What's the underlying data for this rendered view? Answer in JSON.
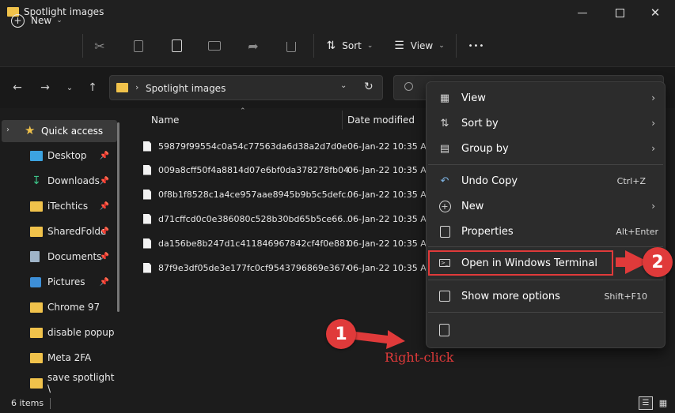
{
  "window": {
    "title": "Spotlight images"
  },
  "toolbar": {
    "new_label": "New",
    "sort_label": "Sort",
    "view_label": "View",
    "more_label": "•••"
  },
  "address": {
    "path": "Spotlight images"
  },
  "sidebar": {
    "quick_access": "Quick access",
    "items": [
      {
        "label": "Desktop",
        "pinned": true
      },
      {
        "label": "Downloads",
        "pinned": true
      },
      {
        "label": "iTechtics",
        "pinned": true
      },
      {
        "label": "SharedFolde",
        "pinned": true
      },
      {
        "label": "Documents",
        "pinned": true
      },
      {
        "label": "Pictures",
        "pinned": true
      },
      {
        "label": "Chrome 97",
        "pinned": false
      },
      {
        "label": "disable popup",
        "pinned": false
      },
      {
        "label": "Meta 2FA",
        "pinned": false
      },
      {
        "label": "save spotlight \\",
        "pinned": false
      }
    ]
  },
  "columns": {
    "name": "Name",
    "date_modified": "Date modified"
  },
  "files": [
    {
      "name": "59879f99554c0a54c77563da6d38a2d7d0e...",
      "date": "06-Jan-22 10:35 AM"
    },
    {
      "name": "009a8cff50f4a8814d07e6bf0da378278fb04...",
      "date": "06-Jan-22 10:35 AM"
    },
    {
      "name": "0f8b1f8528c1a4ce957aae8945b9b5c5defc...",
      "date": "06-Jan-22 10:35 AM"
    },
    {
      "name": "d71cffcd0c0e386080c528b30bd65b5ce66...",
      "date": "06-Jan-22 10:35 AM"
    },
    {
      "name": "da156be8b247d1c411846967842cf4f0e881...",
      "date": "06-Jan-22 10:35 AM"
    },
    {
      "name": "87f9e3df05de3e177fc0cf9543796869e3674...",
      "date": "06-Jan-22 10:35 AM"
    }
  ],
  "status": {
    "item_count": "6 items"
  },
  "context_menu": {
    "view": "View",
    "sort_by": "Sort by",
    "group_by": "Group by",
    "undo_copy": "Undo Copy",
    "undo_copy_shortcut": "Ctrl+Z",
    "new": "New",
    "properties": "Properties",
    "properties_shortcut": "Alt+Enter",
    "open_terminal": "Open in Windows Terminal",
    "show_more": "Show more options",
    "show_more_shortcut": "Shift+F10"
  },
  "annotations": {
    "step1": "1",
    "step2": "2",
    "right_click": "Right-click",
    "color": "#e03a3a"
  }
}
